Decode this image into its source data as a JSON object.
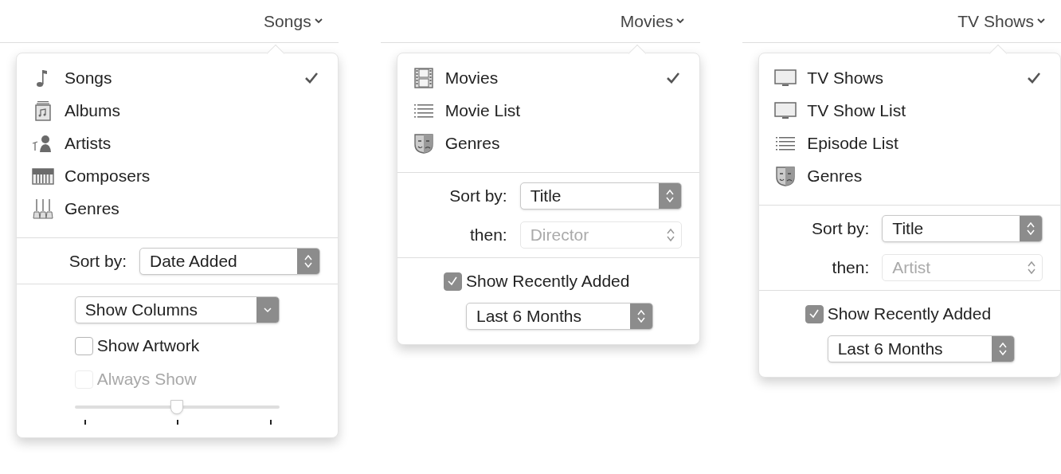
{
  "panels": [
    {
      "view_button": "Songs",
      "items": [
        {
          "kind": "note",
          "label": "Songs",
          "selected": true
        },
        {
          "kind": "album",
          "label": "Albums",
          "selected": false
        },
        {
          "kind": "artist",
          "label": "Artists",
          "selected": false
        },
        {
          "kind": "piano",
          "label": "Composers",
          "selected": false
        },
        {
          "kind": "guitars",
          "label": "Genres",
          "selected": false
        }
      ],
      "groups": [
        [
          {
            "kind": "sort",
            "label": "Sort by:",
            "value": "Date Added",
            "disabled": false
          }
        ],
        [
          {
            "kind": "pulldown",
            "value": "Show Columns"
          },
          {
            "kind": "checkbox",
            "label": "Show Artwork",
            "checked": false,
            "disabled": false
          },
          {
            "kind": "checkbox",
            "label": "Always Show",
            "checked": false,
            "disabled": true
          },
          {
            "kind": "slider",
            "level": 0.5
          }
        ]
      ]
    },
    {
      "view_button": "Movies",
      "items": [
        {
          "kind": "film",
          "label": "Movies",
          "selected": true
        },
        {
          "kind": "list",
          "label": "Movie List",
          "selected": false
        },
        {
          "kind": "masks",
          "label": "Genres",
          "selected": false
        }
      ],
      "groups": [
        [
          {
            "kind": "sort",
            "label": "Sort by:",
            "value": "Title",
            "disabled": false
          },
          {
            "kind": "sort",
            "label": "then:",
            "value": "Director",
            "disabled": true
          }
        ],
        [
          {
            "kind": "checkbox",
            "label": "Show Recently Added",
            "checked": true,
            "disabled": false
          },
          {
            "kind": "popup",
            "value": "Last 6 Months"
          }
        ]
      ]
    },
    {
      "view_button": "TV Shows",
      "items": [
        {
          "kind": "tv",
          "label": "TV Shows",
          "selected": true
        },
        {
          "kind": "tv",
          "label": "TV Show List",
          "selected": false
        },
        {
          "kind": "list",
          "label": "Episode List",
          "selected": false
        },
        {
          "kind": "masks",
          "label": "Genres",
          "selected": false
        }
      ],
      "groups": [
        [
          {
            "kind": "sort",
            "label": "Sort by:",
            "value": "Title",
            "disabled": false
          },
          {
            "kind": "sort",
            "label": "then:",
            "value": "Artist",
            "disabled": true
          }
        ],
        [
          {
            "kind": "checkbox",
            "label": "Show Recently Added",
            "checked": true,
            "disabled": false
          },
          {
            "kind": "popup",
            "value": "Last 6 Months"
          }
        ]
      ]
    }
  ]
}
